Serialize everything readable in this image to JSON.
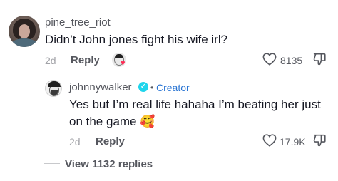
{
  "comment": {
    "username": "pine_tree_riot",
    "text": "Didn’t John jones fight his wife irl?",
    "date": "2d",
    "reply_label": "Reply",
    "like_count": "8135",
    "liked_by_creator_icon": "creator-liked-avatar"
  },
  "reply": {
    "username": "johnnywalker",
    "verified_icon": "verified-check",
    "separator": "•",
    "creator_label": "Creator",
    "text_line1": "Yes but I’m real life hahaha I’m beating her just",
    "text_line2": "on the game",
    "emoji": "🥰",
    "date": "2d",
    "reply_label": "Reply",
    "like_count": "17.9K"
  },
  "view_replies_label": "View 1132 replies",
  "colors": {
    "text_primary": "#161823",
    "text_secondary": "#55575e",
    "text_muted": "#a1a2a7",
    "creator_blue": "#2a75d3",
    "verified_cyan": "#20d5ec",
    "heart_red": "#fe2c55"
  }
}
